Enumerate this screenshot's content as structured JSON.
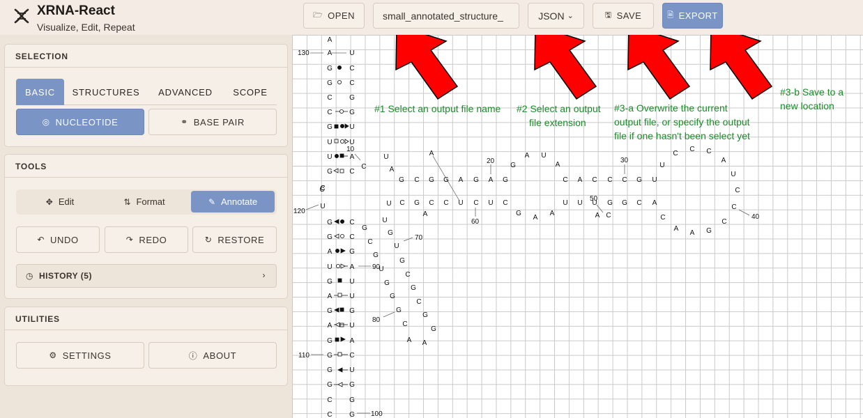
{
  "app": {
    "title": "XRNA-React",
    "subtitle": "Visualize, Edit, Repeat",
    "logo_icon": "dna-helix-icon"
  },
  "toolbar": {
    "open_label": "OPEN",
    "file_name_value": "small_annotated_structure_",
    "extension_value": "JSON",
    "save_label": "SAVE",
    "export_label": "EXPORT",
    "accent": "#7a94c6"
  },
  "selection": {
    "title": "SELECTION",
    "tabs": [
      "BASIC",
      "STRUCTURES",
      "ADVANCED",
      "SCOPE"
    ],
    "active_tab": "BASIC",
    "nucleotide_label": "NUCLEOTIDE",
    "base_pair_label": "BASE PAIR"
  },
  "tools": {
    "title": "TOOLS",
    "modes": [
      "Edit",
      "Format",
      "Annotate"
    ],
    "active_mode": "Annotate",
    "undo_label": "UNDO",
    "redo_label": "REDO",
    "restore_label": "RESTORE",
    "history_label": "HISTORY (5)"
  },
  "utilities": {
    "title": "UTILITIES",
    "settings_label": "SETTINGS",
    "about_label": "ABOUT"
  },
  "annotations": {
    "note1": "#1 Select an output file name",
    "note2_line1": "#2 Select an output",
    "note2_line2": "file extension",
    "note3a_line1": "#3-a Overwrite the current",
    "note3a_line2": "output file, or specify the output",
    "note3a_line3": "file if one hasn't been select yet",
    "note3b_line1": "#3-b Save to a",
    "note3b_line2": "new location",
    "note_color": "#1d8a2a",
    "arrow_color": "#ff0000"
  },
  "structure": {
    "numbers": [
      "130",
      "10",
      "20",
      "30",
      "120",
      "60",
      "50",
      "40",
      "70",
      "90",
      "80",
      "110",
      "100"
    ],
    "nucleotides": {
      "left_strand": [
        "A",
        "A",
        "G",
        "G",
        "C",
        "C",
        "G",
        "U",
        "U",
        "G",
        "C",
        "U",
        "G",
        "G",
        "A",
        "U",
        "G",
        "A",
        "A",
        "A",
        "A",
        "G",
        "G",
        "G",
        "C",
        "C"
      ],
      "right_strand": [
        "U",
        "C",
        "C",
        "G",
        "G",
        "U",
        "U",
        "A",
        "C",
        "C",
        "G",
        "C",
        "G",
        "A",
        "U",
        "U",
        "G",
        "C",
        "A",
        "A",
        "U",
        "G",
        "C",
        "G",
        "G"
      ],
      "hairpin_top": [
        "U",
        "A",
        "C",
        "G",
        "C",
        "G",
        "G",
        "A",
        "G",
        "A",
        "G",
        "A",
        "20",
        "G",
        "A",
        "U",
        "A",
        "C",
        "A",
        "C",
        "C",
        "C",
        "G",
        "U"
      ],
      "hairpin_loop": [
        "C",
        "C",
        "C",
        "A",
        "U",
        "C",
        "C",
        "C",
        "G",
        "A",
        "A",
        "G",
        "C",
        "A"
      ],
      "bottom_strand": [
        "U",
        "C",
        "G",
        "C",
        "C",
        "U",
        "C",
        "U",
        "C",
        "G",
        "A",
        "A",
        "U",
        "U",
        "U",
        "G",
        "G",
        "G",
        "C",
        "A",
        "C",
        "A"
      ],
      "inner_strand": [
        "G",
        "G",
        "G",
        "G",
        "U",
        "U",
        "G",
        "G",
        "G",
        "G",
        "C",
        "C",
        "G",
        "A",
        "A",
        "C",
        "C",
        "G",
        "G",
        "G"
      ]
    }
  }
}
